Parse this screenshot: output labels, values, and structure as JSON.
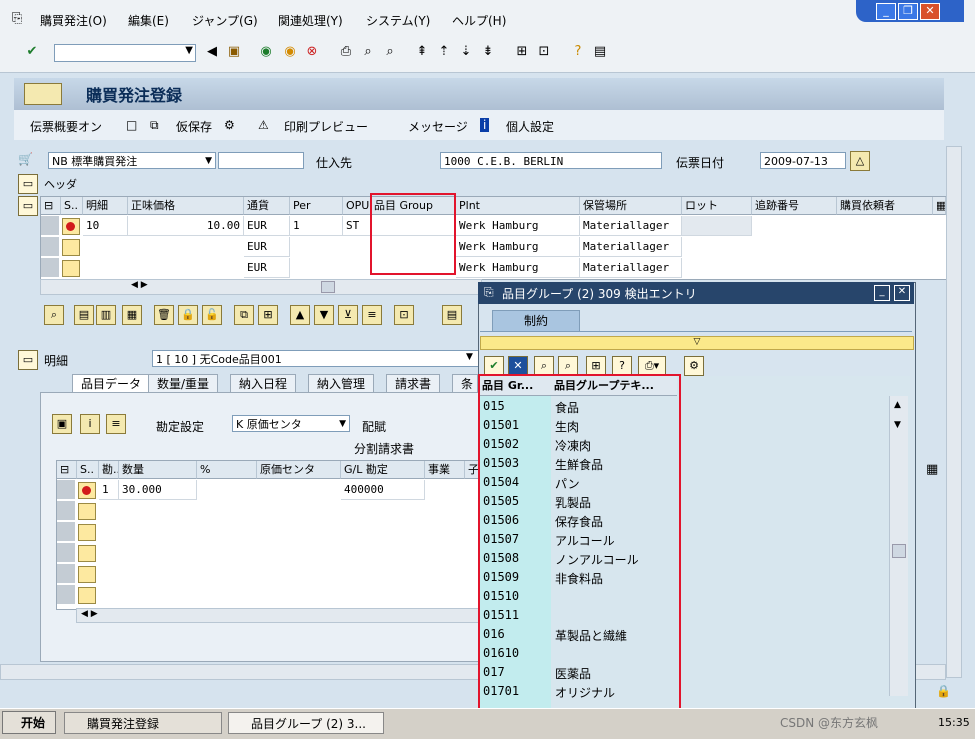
{
  "menu": [
    "購買発注(O)",
    "編集(E)",
    "ジャンプ(G)",
    "関連処理(Y)",
    "システム(Y)",
    "ヘルプ(H)"
  ],
  "page_title": "購買発注登録",
  "toolbar2": {
    "doc_overview": "伝票概要オン",
    "hold": "仮保存",
    "print_preview": "印刷プレビュー",
    "messages": "メッセージ",
    "personal": "個人設定"
  },
  "header": {
    "doc_type": "NB 標準購買発注",
    "vendor_label": "仕入先",
    "vendor_value": "1000 C.E.B. BERLIN",
    "date_label": "伝票日付",
    "date_value": "2009-07-13",
    "header_label": "ヘッダ"
  },
  "items_grid": {
    "columns": [
      "S..",
      "明細",
      "正味価格",
      "通貨",
      "Per",
      "OPU",
      "品目 Group",
      "Plnt",
      "保管場所",
      "ロット",
      "追跡番号",
      "購買依頼者"
    ],
    "rows": [
      {
        "item": "10",
        "price": "10.00",
        "curr": "EUR",
        "per": "1",
        "opu": "ST",
        "plant": "Werk Hamburg",
        "sloc": "Materiallager"
      },
      {
        "item": "",
        "price": "",
        "curr": "EUR",
        "per": "",
        "opu": "",
        "plant": "Werk Hamburg",
        "sloc": "Materiallager"
      },
      {
        "item": "",
        "price": "",
        "curr": "EUR",
        "per": "",
        "opu": "",
        "plant": "Werk Hamburg",
        "sloc": "Materiallager"
      }
    ]
  },
  "detail": {
    "label": "明細",
    "selector": "1 [ 10 ] 无Code品目001",
    "tabs": [
      "品目データ",
      "数量/重量",
      "納入日程",
      "納入管理",
      "請求書",
      "条"
    ]
  },
  "account": {
    "assignment_label": "勘定設定",
    "assignment_value": "K 原価センタ",
    "dist_label": "配賦",
    "split_label": "分割請求書",
    "columns": [
      "S..",
      "勘..",
      "数量",
      "%",
      "原価センタ",
      "G/L 勘定",
      "事業",
      "子"
    ],
    "row": {
      "n": "1",
      "qty": "30.000",
      "gl": "400000"
    }
  },
  "popup": {
    "title": "品目グループ (2)  309 検出エントリ",
    "tab": "制約",
    "col_code": "品目 Gr...",
    "col_desc": "品目グループテキ...",
    "rows": [
      [
        "015",
        "食品"
      ],
      [
        "01501",
        "生肉"
      ],
      [
        "01502",
        "冷凍肉"
      ],
      [
        "01503",
        "生鮮食品"
      ],
      [
        "01504",
        "パン"
      ],
      [
        "01505",
        "乳製品"
      ],
      [
        "01506",
        "保存食品"
      ],
      [
        "01507",
        "アルコール"
      ],
      [
        "01508",
        "ノンアルコール"
      ],
      [
        "01509",
        "非食料品"
      ],
      [
        "01510",
        ""
      ],
      [
        "01511",
        ""
      ],
      [
        "016",
        "革製品と繊維"
      ],
      [
        "01610",
        ""
      ],
      [
        "017",
        "医薬品"
      ],
      [
        "01701",
        "オリジナル"
      ]
    ]
  },
  "taskbar": {
    "start": "开始",
    "task1": "購買発注登録",
    "task2": "品目グループ (2)  3...",
    "clock": "15:35",
    "watermark": "CSDN @东方玄枫"
  }
}
